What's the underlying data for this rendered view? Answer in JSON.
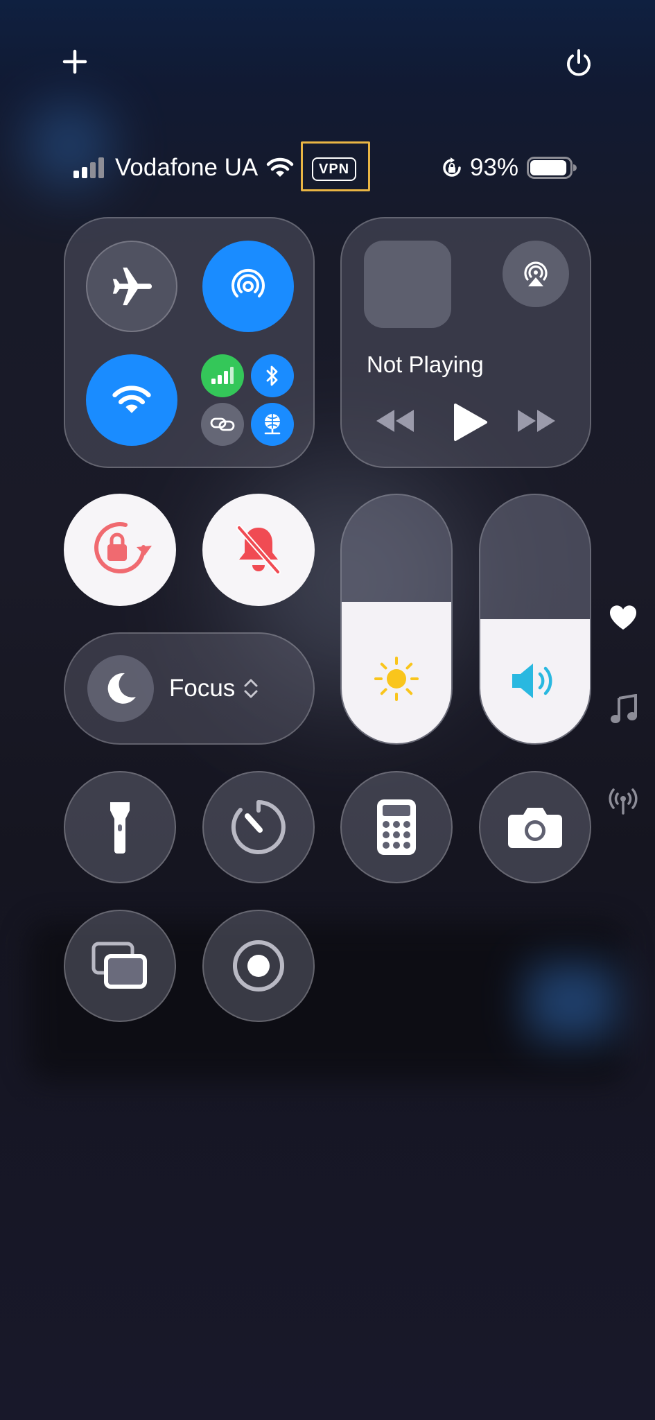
{
  "status_bar": {
    "carrier": "Vodafone UA",
    "vpn_label": "VPN",
    "battery_percent": "93%",
    "battery_level": 0.93,
    "signal_bars_active": 2,
    "signal_bars_total": 4
  },
  "media": {
    "now_playing": "Not Playing"
  },
  "focus": {
    "label": "Focus"
  },
  "sliders": {
    "brightness_level": 0.57,
    "volume_level": 0.5
  },
  "colors": {
    "accent_blue": "#1a8cff",
    "cellular_green": "#34c759",
    "lock_red": "#f06a70",
    "bell_red": "#f04b53",
    "sun_yellow": "#f9c51c",
    "speaker_cyan": "#29b8e0",
    "vpn_highlight": "#e9b544"
  },
  "icons": {
    "add": "plus-icon",
    "power": "power-icon",
    "airplane": "airplane-icon",
    "airdrop": "airdrop-icon",
    "wifi": "wifi-icon",
    "cellular": "cellular-icon",
    "bluetooth": "bluetooth-icon",
    "personal_hotspot": "link-icon",
    "vpn": "globe-network-icon",
    "airplay": "airplay-icon",
    "rewind": "rewind-icon",
    "play": "play-icon",
    "fast_forward": "fast-forward-icon",
    "orientation_lock": "orientation-lock-icon",
    "silent": "bell-slash-icon",
    "focus": "moon-icon",
    "brightness": "sun-icon",
    "volume": "speaker-icon",
    "flashlight": "flashlight-icon",
    "timer": "timer-icon",
    "calculator": "calculator-icon",
    "camera": "camera-icon",
    "screen_mirroring": "screen-mirroring-icon",
    "screen_recording": "record-icon",
    "favorites": "heart-icon",
    "music": "music-note-icon",
    "connectivity": "antenna-icon"
  }
}
